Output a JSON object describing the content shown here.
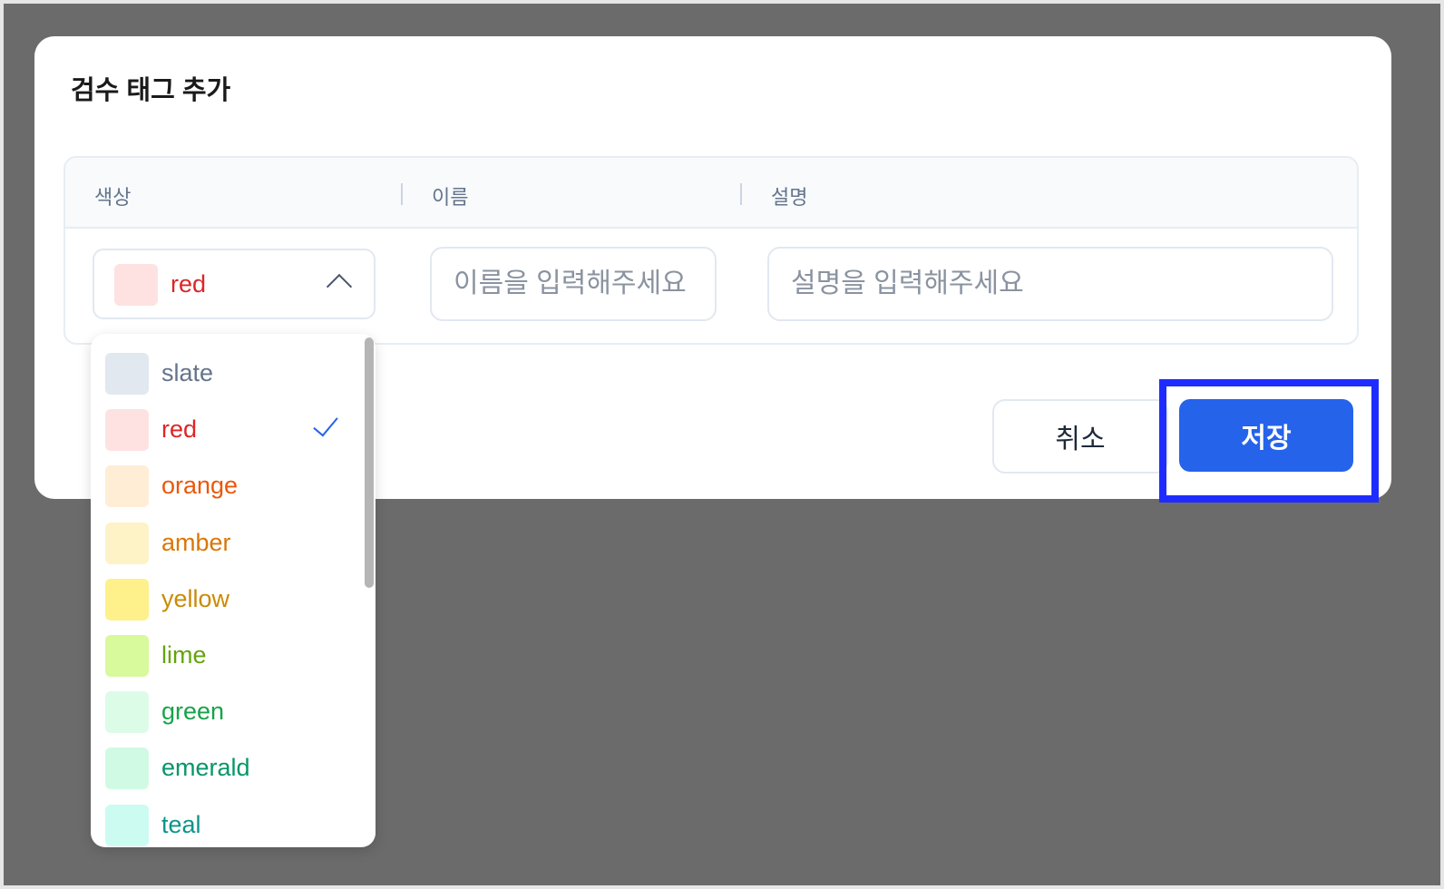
{
  "modal": {
    "title": "검수 태그 추가",
    "columns": {
      "color": "색상",
      "name": "이름",
      "description": "설명"
    },
    "color_select": {
      "selected": "red",
      "swatch_color": "#fee2e2",
      "text_color": "#dc2626"
    },
    "name_input": {
      "placeholder": "이름을 입력해주세요",
      "value": ""
    },
    "description_input": {
      "placeholder": "설명을 입력해주세요",
      "value": ""
    },
    "buttons": {
      "cancel": "취소",
      "save": "저장"
    }
  },
  "dropdown": {
    "options": [
      {
        "label": "slate",
        "swatch": "#e2e8f0",
        "text": "#64748b",
        "selected": false
      },
      {
        "label": "red",
        "swatch": "#fee2e2",
        "text": "#dc2626",
        "selected": true
      },
      {
        "label": "orange",
        "swatch": "#ffedd5",
        "text": "#ea580c",
        "selected": false
      },
      {
        "label": "amber",
        "swatch": "#fef3c7",
        "text": "#d97706",
        "selected": false
      },
      {
        "label": "yellow",
        "swatch": "#fef08a",
        "text": "#ca8a04",
        "selected": false
      },
      {
        "label": "lime",
        "swatch": "#d9f99d",
        "text": "#65a30d",
        "selected": false
      },
      {
        "label": "green",
        "swatch": "#dcfce7",
        "text": "#16a34a",
        "selected": false
      },
      {
        "label": "emerald",
        "swatch": "#d1fae5",
        "text": "#059669",
        "selected": false
      },
      {
        "label": "teal",
        "swatch": "#ccfbf1",
        "text": "#0d9488",
        "selected": false
      }
    ],
    "check_icon": "check-icon"
  },
  "colors": {
    "primary": "#2563eb",
    "highlight": "#1f2cff",
    "backdrop": "#6b6b6b"
  }
}
